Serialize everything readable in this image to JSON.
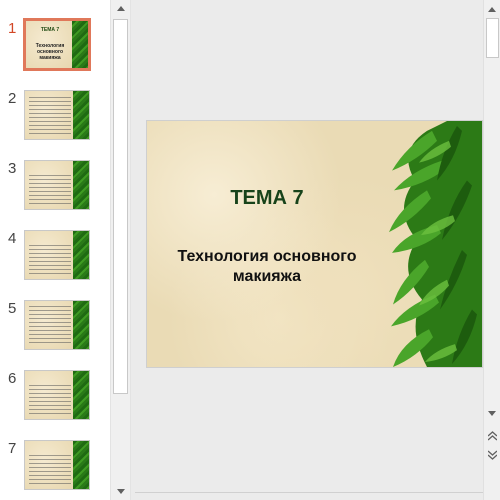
{
  "thumbnails": [
    {
      "number": "1",
      "title": "ТЕМА 7",
      "subtitle": "Технология основного макияжа",
      "active": true
    },
    {
      "number": "2",
      "active": false
    },
    {
      "number": "3",
      "active": false
    },
    {
      "number": "4",
      "active": false
    },
    {
      "number": "5",
      "active": false
    },
    {
      "number": "6",
      "active": false
    },
    {
      "number": "7",
      "active": false
    }
  ],
  "slide": {
    "title": "ТЕМА 7",
    "subtitle_line1": "Технология основного",
    "subtitle_line2": "макияжа"
  },
  "icons": {
    "scroll_up": "triangle-up-icon",
    "scroll_down": "triangle-down-icon",
    "prev_slide": "double-chevron-up-icon",
    "next_slide": "double-chevron-down-icon"
  },
  "colors": {
    "active_number": "#d24726",
    "active_border": "#e0785a",
    "title_green": "#17431a"
  }
}
